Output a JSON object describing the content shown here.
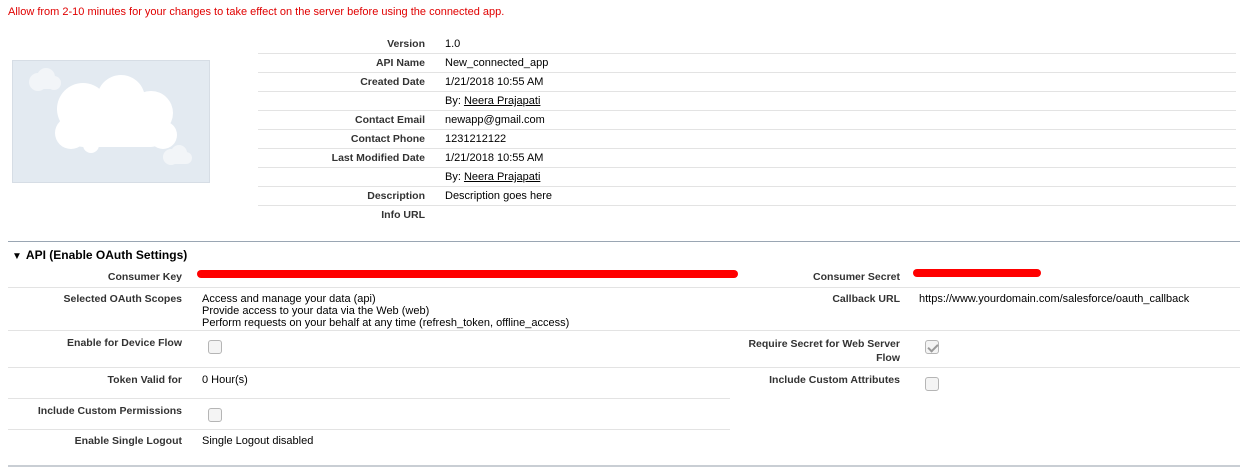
{
  "notice": "Allow from 2-10 minutes for your changes to take effect on the server before using the connected app.",
  "logo": {
    "icon": "cloud-logo-icon"
  },
  "details": [
    {
      "label": "Version",
      "value": "1.0"
    },
    {
      "label": "API Name",
      "value": "New_connected_app"
    },
    {
      "label": "Created Date",
      "value": "1/21/2018 10:55 AM"
    },
    {
      "label": "",
      "by_prefix": "By: ",
      "by_name": "Neera Prajapati"
    },
    {
      "label": "Contact Email",
      "value": "newapp@gmail.com"
    },
    {
      "label": "Contact Phone",
      "value": "1231212122"
    },
    {
      "label": "Last Modified Date",
      "value": "1/21/2018 10:55 AM"
    },
    {
      "label": "",
      "by_prefix": "By: ",
      "by_name": "Neera Prajapati"
    },
    {
      "label": "Description",
      "value": "Description goes here"
    },
    {
      "label": "Info URL",
      "value": ""
    }
  ],
  "oauth": {
    "section_title": "API (Enable OAuth Settings)",
    "consumer_key_label": "Consumer Key",
    "consumer_secret_label": "Consumer Secret",
    "scopes_label": "Selected OAuth Scopes",
    "scopes": [
      "Access and manage your data (api)",
      "Provide access to your data via the Web (web)",
      "Perform requests on your behalf at any time (refresh_token, offline_access)"
    ],
    "callback_label": "Callback URL",
    "callback_value": "https://www.yourdomain.com/salesforce/oauth_callback",
    "device_flow_label": "Enable for Device Flow",
    "device_flow_checked": false,
    "require_secret_label_1": "Require Secret for Web Server",
    "require_secret_label_2": "Flow",
    "require_secret_checked": true,
    "token_valid_label": "Token Valid for",
    "token_valid_value": "0 Hour(s)",
    "custom_attributes_label": "Include Custom Attributes",
    "custom_attributes_checked": false,
    "custom_permissions_label": "Include Custom Permissions",
    "custom_permissions_checked": false,
    "single_logout_label": "Enable Single Logout",
    "single_logout_value": "Single Logout disabled"
  },
  "colors": {
    "notice": "#e00000",
    "redaction": "#ff0000",
    "logo_bg": "#e3eaf1"
  }
}
